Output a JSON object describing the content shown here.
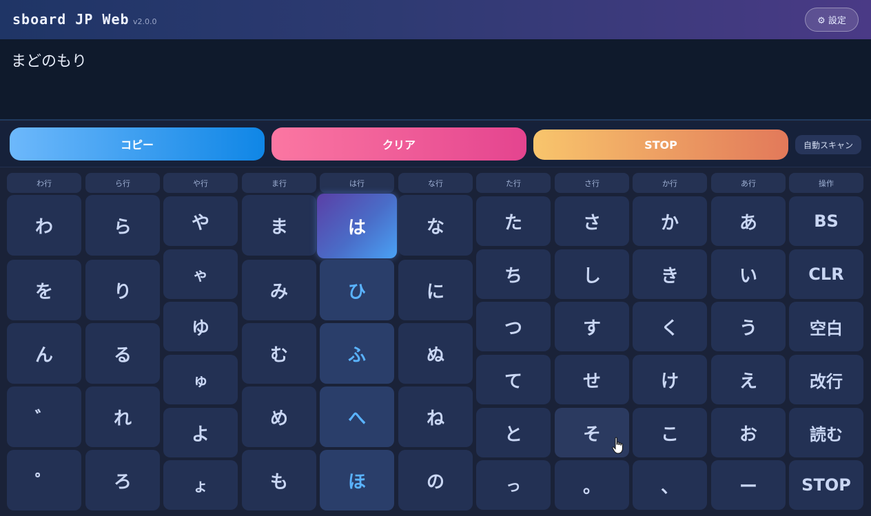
{
  "header": {
    "title": "sboard JP Web",
    "version": "v2.0.0",
    "settings_label": "⚙ 設定"
  },
  "editor": {
    "text": "まどのもり"
  },
  "actions": {
    "copy": "コピー",
    "clear": "クリア",
    "stop": "STOP",
    "auto_scan": "自動スキャン"
  },
  "columns": [
    {
      "header": "わ行",
      "keys": [
        "わ",
        "を",
        "ん",
        "゛",
        "゜"
      ]
    },
    {
      "header": "ら行",
      "keys": [
        "ら",
        "り",
        "る",
        "れ",
        "ろ"
      ]
    },
    {
      "header": "や行",
      "keys": [
        "や",
        "ゃ",
        "ゆ",
        "ゅ",
        "よ",
        "ょ"
      ]
    },
    {
      "header": "ま行",
      "keys": [
        "ま",
        "み",
        "む",
        "め",
        "も"
      ]
    },
    {
      "header": "は行",
      "keys": [
        "は",
        "ひ",
        "ふ",
        "へ",
        "ほ"
      ]
    },
    {
      "header": "な行",
      "keys": [
        "な",
        "に",
        "ぬ",
        "ね",
        "の"
      ]
    },
    {
      "header": "た行",
      "keys": [
        "た",
        "ち",
        "つ",
        "て",
        "と",
        "っ"
      ]
    },
    {
      "header": "さ行",
      "keys": [
        "さ",
        "し",
        "す",
        "せ",
        "そ",
        "。"
      ]
    },
    {
      "header": "か行",
      "keys": [
        "か",
        "き",
        "く",
        "け",
        "こ",
        "、"
      ]
    },
    {
      "header": "あ行",
      "keys": [
        "あ",
        "い",
        "う",
        "え",
        "お",
        "ー"
      ]
    },
    {
      "header": "操作",
      "keys": [
        "BS",
        "CLR",
        "空白",
        "改行",
        "読む",
        "STOP"
      ]
    }
  ],
  "state": {
    "active_column": "は行",
    "active_key": "は",
    "hovered_key": "そ"
  }
}
